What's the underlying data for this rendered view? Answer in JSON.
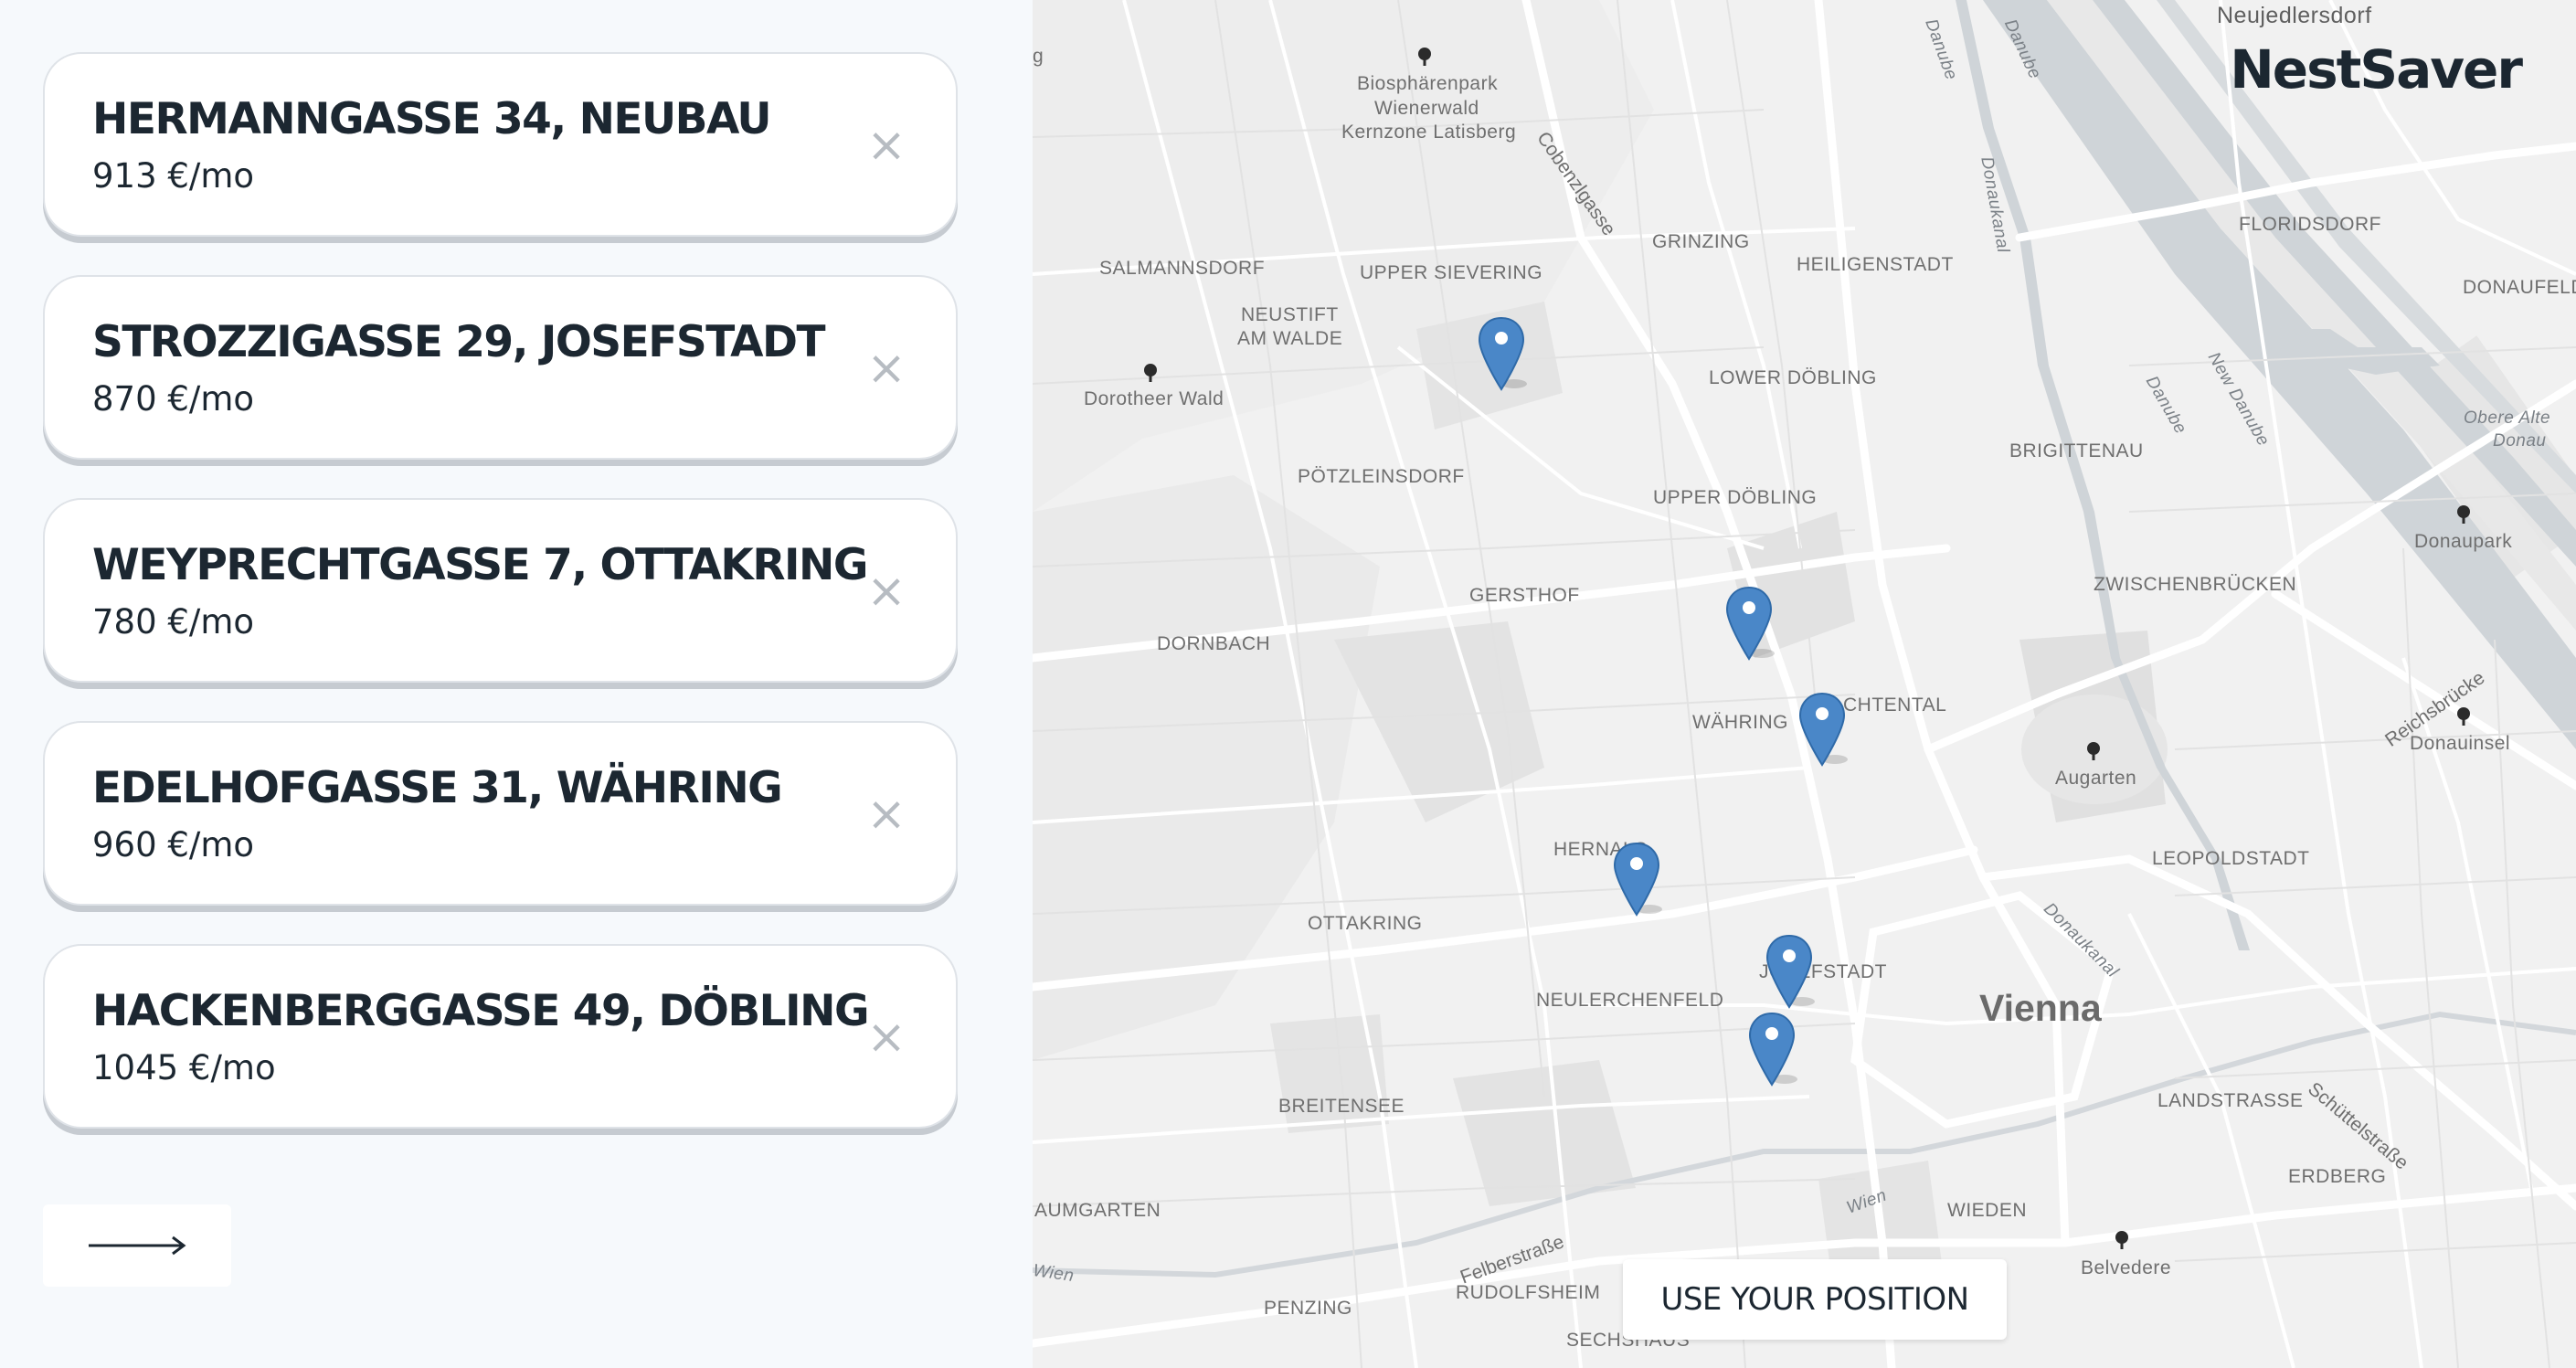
{
  "listings": [
    {
      "address": "HERMANNGASSE 34, NEUBAU",
      "price": "913 €/mo"
    },
    {
      "address": "STROZZIGASSE 29, JOSEFSTADT",
      "price": "870 €/mo"
    },
    {
      "address": "WEYPRECHTGASSE 7, OTTAKRING",
      "price": "780 €/mo"
    },
    {
      "address": "EDELHOFGASSE 31, WÄHRING",
      "price": "960 €/mo"
    },
    {
      "address": "HACKENBERGGASSE 49, DÖBLING",
      "price": "1045 €/mo"
    }
  ],
  "close_glyph": "×",
  "next_icon": "long-arrow-right-icon",
  "brand": "NestSaver",
  "use_position_label": "USE YOUR POSITION",
  "map": {
    "places": {
      "neujedlersdorf": "Neujedlersdorf",
      "biosphaere": "Biosphärenpark",
      "wienerwald": "Wienerwald",
      "kernzone": "Kernzone Latisberg",
      "cobenzlgasse": "Cobenzlgasse",
      "salmannsdorf": "SALMANNSDORF",
      "upper_sievering": "UPPER SIEVERING",
      "grinzing": "GRINZING",
      "heiligenstadt": "HEILIGENSTADT",
      "floridsdorf": "FLORIDSDORF",
      "donaufeld": "DONAUFELD",
      "neustift1": "NEUSTIFT",
      "neustift2": "AM WALDE",
      "dorotheer": "Dorotheer Wald",
      "lower_doebling": "LOWER DÖBLING",
      "brigittenau": "BRIGITTENAU",
      "poetzleinsdorf": "PÖTZLEINSDORF",
      "upper_doebling": "UPPER DÖBLING",
      "donaupark": "Donaupark",
      "gersthof": "GERSTHOF",
      "zwischenbruecken": "ZWISCHENBRÜCKEN",
      "dornbach": "DORNBACH",
      "waehring": "WÄHRING",
      "lichtental": "CHTENTAL",
      "donauinsel": "Donauinsel",
      "augarten": "Augarten",
      "hernals": "HERNALS",
      "leopoldstadt": "LEOPOLDSTADT",
      "ottakring": "OTTAKRING",
      "josefstadt": "JOSEFSTADT",
      "vienna": "Vienna",
      "neulerchenfeld": "NEULERCHENFELD",
      "breitensee": "BREITENSEE",
      "landstrasse": "LANDSTRASSE",
      "erdberg": "ERDBERG",
      "baumgarten": "AUMGARTEN",
      "wieden": "WIEDEN",
      "felberstrasse": "Felberstraße",
      "belvedere": "Belvedere",
      "rudolfsheim": "RUDOLFSHEIM",
      "penzing": "PENZING",
      "sechshaus": "SECHSHAUS",
      "wien_river": "Wien",
      "wien_river2": "Wien",
      "danube1": "Danube",
      "danube2": "Danube",
      "danube3": "Danube",
      "new_danube": "New Danube",
      "donaukanal1": "Donaukanal",
      "donaukanal2": "Donaukanal",
      "obere1": "Obere Alte",
      "obere2": "Donau",
      "reichsbruecke": "Reichsbrücke",
      "schuettel": "Schüttelstraße",
      "edge_g": "g"
    }
  }
}
